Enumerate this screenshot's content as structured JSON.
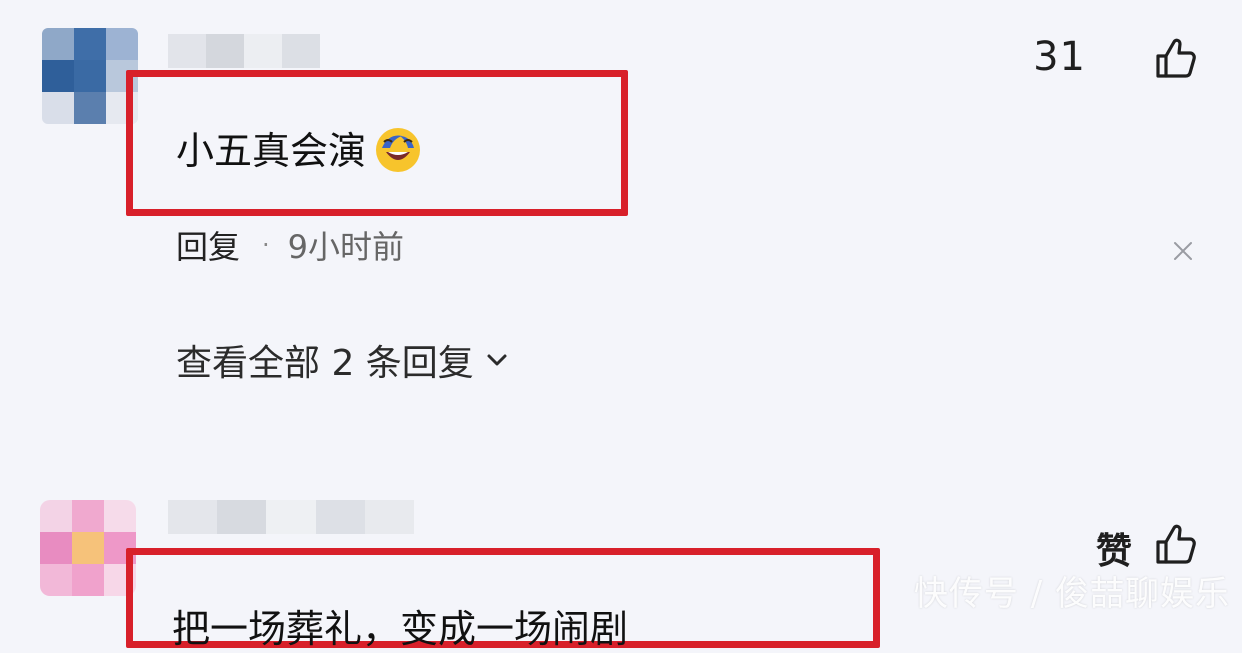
{
  "comments": [
    {
      "likes": "31",
      "text": "小五真会演",
      "reply_label": "回复",
      "separator": "·",
      "time": "9小时前",
      "view_replies": "查看全部 2 条回复"
    },
    {
      "like_label": "赞",
      "text": "把一场葬礼，变成一场闹剧"
    }
  ],
  "watermark": "快传号 / 俊喆聊娱乐",
  "colors": {
    "highlight": "#d8202a",
    "background": "#f4f5fa"
  },
  "icons": [
    "thumbs-up-icon",
    "close-icon",
    "chevron-down-icon",
    "laughing-crying-emoji"
  ]
}
